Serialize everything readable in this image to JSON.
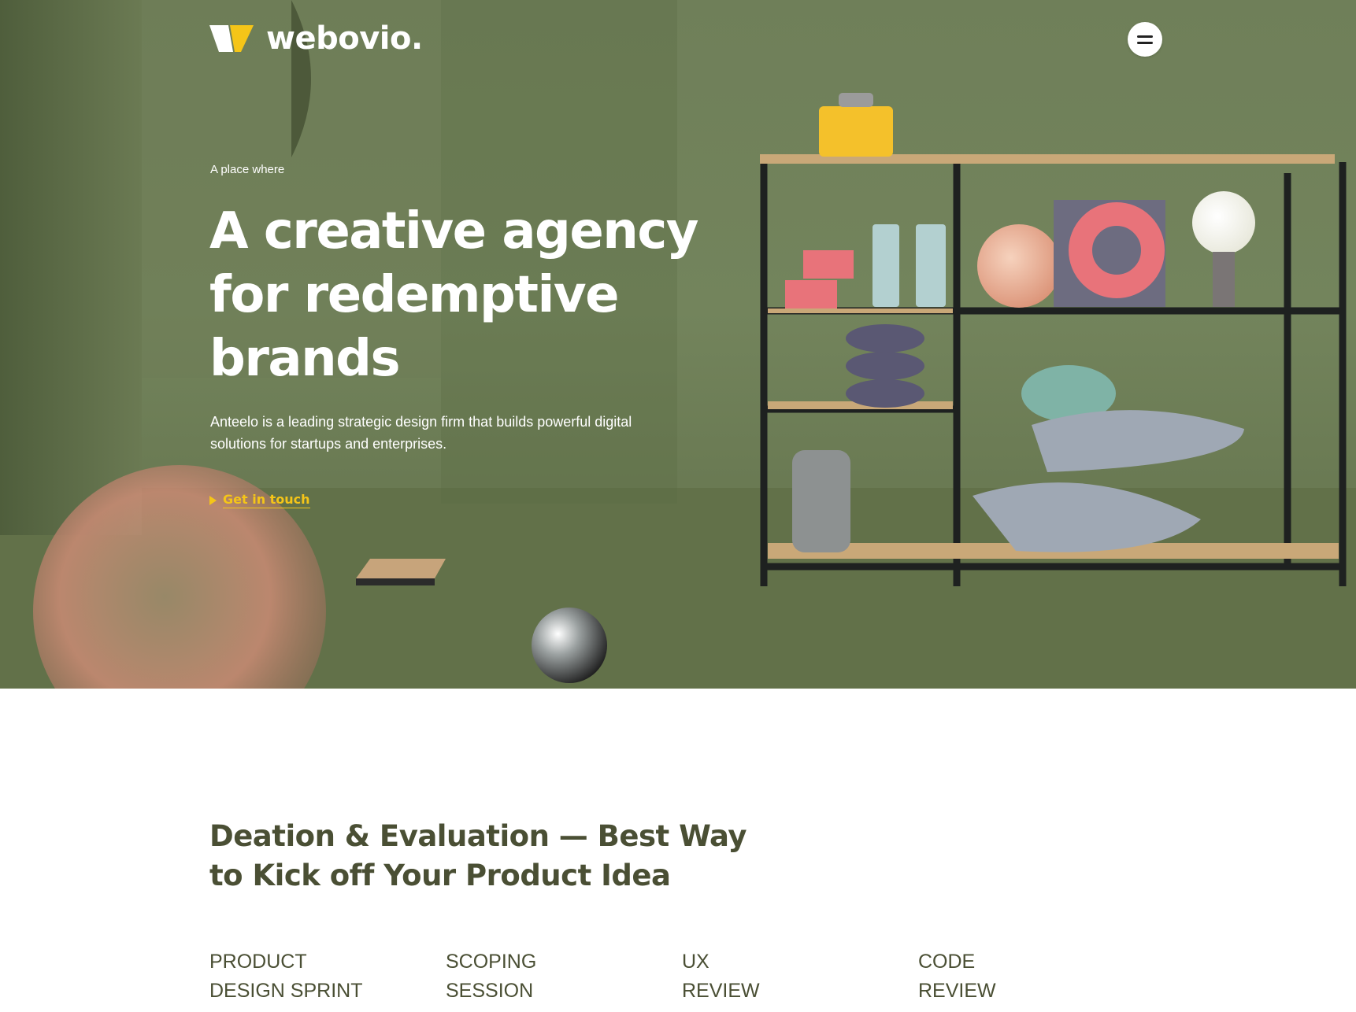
{
  "brand": {
    "name": "webovio.",
    "logo_colors": [
      "#ffffff",
      "#f5c518"
    ]
  },
  "header": {
    "menu_icon": "hamburger-icon"
  },
  "hero": {
    "eyebrow": "A place where",
    "headline_lines": [
      "A creative agency",
      "for redemptive",
      "brands"
    ],
    "description_lines": [
      "Anteelo is a leading strategic design firm that builds powerful digital",
      "solutions for startups and enterprises."
    ],
    "cta_label": "Get in touch",
    "background_color": "#73845c",
    "accent_color": "#f5c518"
  },
  "section": {
    "title_lines": [
      "Deation & Evaluation — Best Way",
      "to Kick off Your Product Idea"
    ],
    "services": [
      {
        "line1": "PRODUCT",
        "line2": "DESIGN SPRINT"
      },
      {
        "line1": "SCOPING",
        "line2": "SESSION"
      },
      {
        "line1": "UX",
        "line2": "REVIEW"
      },
      {
        "line1": "CODE",
        "line2": "REVIEW"
      }
    ],
    "text_color": "#4a4f34"
  }
}
